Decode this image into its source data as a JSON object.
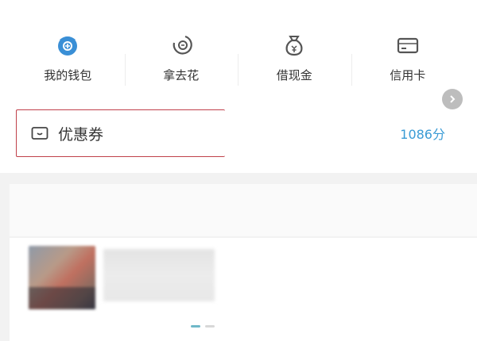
{
  "quick_actions": [
    {
      "label": "我的钱包",
      "icon": "wallet-icon",
      "color": "#3a8fd6"
    },
    {
      "label": "拿去花",
      "icon": "moon-pay-icon",
      "color": "#555555"
    },
    {
      "label": "借现金",
      "icon": "money-bag-icon",
      "color": "#555555"
    },
    {
      "label": "信用卡",
      "icon": "credit-card-icon",
      "color": "#555555"
    }
  ],
  "coupon": {
    "label": "优惠券",
    "icon": "ticket-icon",
    "points": "1086分"
  },
  "colors": {
    "accent": "#3a9bd5",
    "highlight_border": "#c0404a"
  }
}
